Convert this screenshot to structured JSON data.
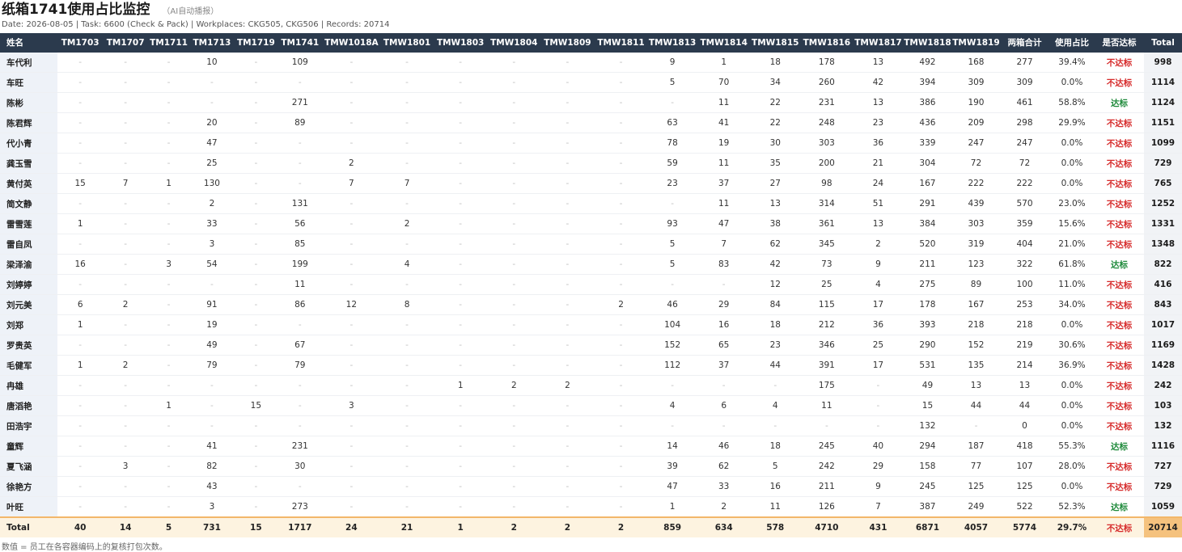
{
  "header": {
    "title": "纸箱1741使用占比监控",
    "tag": "（AI自动播报）",
    "meta": "Date: 2026-08-05 | Task: 6600 (Check & Pack) | Workplaces: CKG505, CKG506 | Records: 20714"
  },
  "columns": [
    "姓名",
    "TM1703",
    "TM1707",
    "TM1711",
    "TM1713",
    "TM1719",
    "TM1741",
    "TMW1018A",
    "TMW1801",
    "TMW1803",
    "TMW1804",
    "TMW1809",
    "TMW1811",
    "TMW1813",
    "TMW1814",
    "TMW1815",
    "TMW1816",
    "TMW1817",
    "TMW1818",
    "TMW1819",
    "两箱合计",
    "使用占比",
    "是否达标",
    "Total"
  ],
  "rows": [
    [
      "车代利",
      "-",
      "-",
      "-",
      "10",
      "-",
      "109",
      "-",
      "-",
      "-",
      "-",
      "-",
      "-",
      "9",
      "1",
      "18",
      "178",
      "13",
      "492",
      "168",
      "277",
      "39.4%",
      "不达标",
      "998"
    ],
    [
      "车旺",
      "-",
      "-",
      "-",
      "-",
      "-",
      "-",
      "-",
      "-",
      "-",
      "-",
      "-",
      "-",
      "5",
      "70",
      "34",
      "260",
      "42",
      "394",
      "309",
      "309",
      "0.0%",
      "不达标",
      "1114"
    ],
    [
      "陈彬",
      "-",
      "-",
      "-",
      "-",
      "-",
      "271",
      "-",
      "-",
      "-",
      "-",
      "-",
      "-",
      "-",
      "11",
      "22",
      "231",
      "13",
      "386",
      "190",
      "461",
      "58.8%",
      "达标",
      "1124"
    ],
    [
      "陈君辉",
      "-",
      "-",
      "-",
      "20",
      "-",
      "89",
      "-",
      "-",
      "-",
      "-",
      "-",
      "-",
      "63",
      "41",
      "22",
      "248",
      "23",
      "436",
      "209",
      "298",
      "29.9%",
      "不达标",
      "1151"
    ],
    [
      "代小青",
      "-",
      "-",
      "-",
      "47",
      "-",
      "-",
      "-",
      "-",
      "-",
      "-",
      "-",
      "-",
      "78",
      "19",
      "30",
      "303",
      "36",
      "339",
      "247",
      "247",
      "0.0%",
      "不达标",
      "1099"
    ],
    [
      "龚玉雪",
      "-",
      "-",
      "-",
      "25",
      "-",
      "-",
      "2",
      "-",
      "-",
      "-",
      "-",
      "-",
      "59",
      "11",
      "35",
      "200",
      "21",
      "304",
      "72",
      "72",
      "0.0%",
      "不达标",
      "729"
    ],
    [
      "黄付英",
      "15",
      "7",
      "1",
      "130",
      "-",
      "-",
      "7",
      "7",
      "-",
      "-",
      "-",
      "-",
      "23",
      "37",
      "27",
      "98",
      "24",
      "167",
      "222",
      "222",
      "0.0%",
      "不达标",
      "765"
    ],
    [
      "简文静",
      "-",
      "-",
      "-",
      "2",
      "-",
      "131",
      "-",
      "-",
      "-",
      "-",
      "-",
      "-",
      "-",
      "11",
      "13",
      "314",
      "51",
      "291",
      "439",
      "570",
      "23.0%",
      "不达标",
      "1252"
    ],
    [
      "雷雪莲",
      "1",
      "-",
      "-",
      "33",
      "-",
      "56",
      "-",
      "2",
      "-",
      "-",
      "-",
      "-",
      "93",
      "47",
      "38",
      "361",
      "13",
      "384",
      "303",
      "359",
      "15.6%",
      "不达标",
      "1331"
    ],
    [
      "雷自凤",
      "-",
      "-",
      "-",
      "3",
      "-",
      "85",
      "-",
      "-",
      "-",
      "-",
      "-",
      "-",
      "5",
      "7",
      "62",
      "345",
      "2",
      "520",
      "319",
      "404",
      "21.0%",
      "不达标",
      "1348"
    ],
    [
      "梁泽渝",
      "16",
      "-",
      "3",
      "54",
      "-",
      "199",
      "-",
      "4",
      "-",
      "-",
      "-",
      "-",
      "5",
      "83",
      "42",
      "73",
      "9",
      "211",
      "123",
      "322",
      "61.8%",
      "达标",
      "822"
    ],
    [
      "刘婷婷",
      "-",
      "-",
      "-",
      "-",
      "-",
      "11",
      "-",
      "-",
      "-",
      "-",
      "-",
      "-",
      "-",
      "-",
      "12",
      "25",
      "4",
      "275",
      "89",
      "100",
      "11.0%",
      "不达标",
      "416"
    ],
    [
      "刘元美",
      "6",
      "2",
      "-",
      "91",
      "-",
      "86",
      "12",
      "8",
      "-",
      "-",
      "-",
      "2",
      "46",
      "29",
      "84",
      "115",
      "17",
      "178",
      "167",
      "253",
      "34.0%",
      "不达标",
      "843"
    ],
    [
      "刘郑",
      "1",
      "-",
      "-",
      "19",
      "-",
      "-",
      "-",
      "-",
      "-",
      "-",
      "-",
      "-",
      "104",
      "16",
      "18",
      "212",
      "36",
      "393",
      "218",
      "218",
      "0.0%",
      "不达标",
      "1017"
    ],
    [
      "罗贵英",
      "-",
      "-",
      "-",
      "49",
      "-",
      "67",
      "-",
      "-",
      "-",
      "-",
      "-",
      "-",
      "152",
      "65",
      "23",
      "346",
      "25",
      "290",
      "152",
      "219",
      "30.6%",
      "不达标",
      "1169"
    ],
    [
      "毛健军",
      "1",
      "2",
      "-",
      "79",
      "-",
      "79",
      "-",
      "-",
      "-",
      "-",
      "-",
      "-",
      "112",
      "37",
      "44",
      "391",
      "17",
      "531",
      "135",
      "214",
      "36.9%",
      "不达标",
      "1428"
    ],
    [
      "冉雄",
      "-",
      "-",
      "-",
      "-",
      "-",
      "-",
      "-",
      "-",
      "1",
      "2",
      "2",
      "-",
      "-",
      "-",
      "-",
      "175",
      "-",
      "49",
      "13",
      "13",
      "0.0%",
      "不达标",
      "242"
    ],
    [
      "唐滔艳",
      "-",
      "-",
      "1",
      "-",
      "15",
      "-",
      "3",
      "-",
      "-",
      "-",
      "-",
      "-",
      "4",
      "6",
      "4",
      "11",
      "-",
      "15",
      "44",
      "44",
      "0.0%",
      "不达标",
      "103"
    ],
    [
      "田浩宇",
      "-",
      "-",
      "-",
      "-",
      "-",
      "-",
      "-",
      "-",
      "-",
      "-",
      "-",
      "-",
      "-",
      "-",
      "-",
      "-",
      "-",
      "132",
      "-",
      "0",
      "0.0%",
      "不达标",
      "132"
    ],
    [
      "童辉",
      "-",
      "-",
      "-",
      "41",
      "-",
      "231",
      "-",
      "-",
      "-",
      "-",
      "-",
      "-",
      "14",
      "46",
      "18",
      "245",
      "40",
      "294",
      "187",
      "418",
      "55.3%",
      "达标",
      "1116"
    ],
    [
      "夏飞涵",
      "-",
      "3",
      "-",
      "82",
      "-",
      "30",
      "-",
      "-",
      "-",
      "-",
      "-",
      "-",
      "39",
      "62",
      "5",
      "242",
      "29",
      "158",
      "77",
      "107",
      "28.0%",
      "不达标",
      "727"
    ],
    [
      "徐艳方",
      "-",
      "-",
      "-",
      "43",
      "-",
      "-",
      "-",
      "-",
      "-",
      "-",
      "-",
      "-",
      "47",
      "33",
      "16",
      "211",
      "9",
      "245",
      "125",
      "125",
      "0.0%",
      "不达标",
      "729"
    ],
    [
      "叶旺",
      "-",
      "-",
      "-",
      "3",
      "-",
      "273",
      "-",
      "-",
      "-",
      "-",
      "-",
      "-",
      "1",
      "2",
      "11",
      "126",
      "7",
      "387",
      "249",
      "522",
      "52.3%",
      "达标",
      "1059"
    ]
  ],
  "total_row": [
    "Total",
    "40",
    "14",
    "5",
    "731",
    "15",
    "1717",
    "24",
    "21",
    "1",
    "2",
    "2",
    "2",
    "859",
    "634",
    "578",
    "4710",
    "431",
    "6871",
    "4057",
    "5774",
    "29.7%",
    "不达标",
    "20714"
  ],
  "status_labels": {
    "pass": "达标",
    "fail": "不达标"
  },
  "footnote": "数值 = 员工在各容器编码上的复核打包次数。",
  "colors": {
    "header_bg": "#2b3a4d",
    "fail": "#d62a2a",
    "pass": "#1f8a3b",
    "total_row_bg": "#fdf3e0",
    "grand_total_bg": "#f5c27e",
    "name_col_bg": "#eef2f8"
  }
}
